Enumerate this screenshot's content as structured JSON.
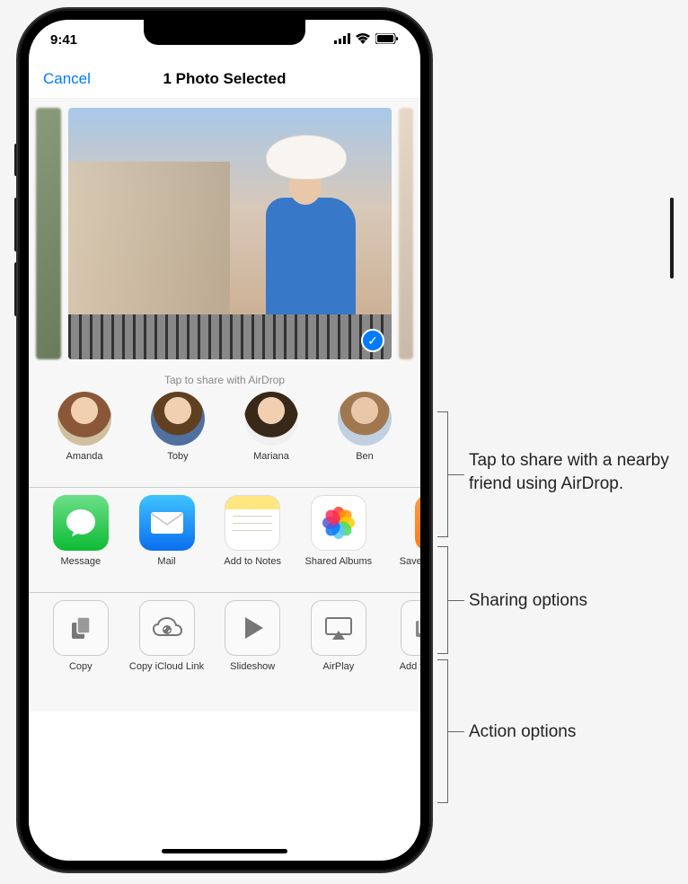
{
  "status": {
    "time": "9:41"
  },
  "nav": {
    "cancel": "Cancel",
    "title": "1 Photo Selected"
  },
  "airdrop": {
    "label": "Tap to share with AirDrop",
    "contacts": [
      {
        "name": "Amanda"
      },
      {
        "name": "Toby"
      },
      {
        "name": "Mariana"
      },
      {
        "name": "Ben"
      }
    ]
  },
  "apps": [
    {
      "name": "Message",
      "icon": "message"
    },
    {
      "name": "Mail",
      "icon": "mail"
    },
    {
      "name": "Add to Notes",
      "icon": "notes"
    },
    {
      "name": "Shared Albums",
      "icon": "photos"
    },
    {
      "name": "Save PDF to Books",
      "icon": "books"
    }
  ],
  "actions": [
    {
      "name": "Copy",
      "icon": "copy"
    },
    {
      "name": "Copy iCloud Link",
      "icon": "cloud-link"
    },
    {
      "name": "Slideshow",
      "icon": "play"
    },
    {
      "name": "AirPlay",
      "icon": "airplay"
    },
    {
      "name": "Add to Album",
      "icon": "add-album"
    }
  ],
  "callouts": {
    "airdrop": "Tap to share with a nearby friend using AirDrop.",
    "sharing": "Sharing options",
    "actions": "Action options"
  }
}
